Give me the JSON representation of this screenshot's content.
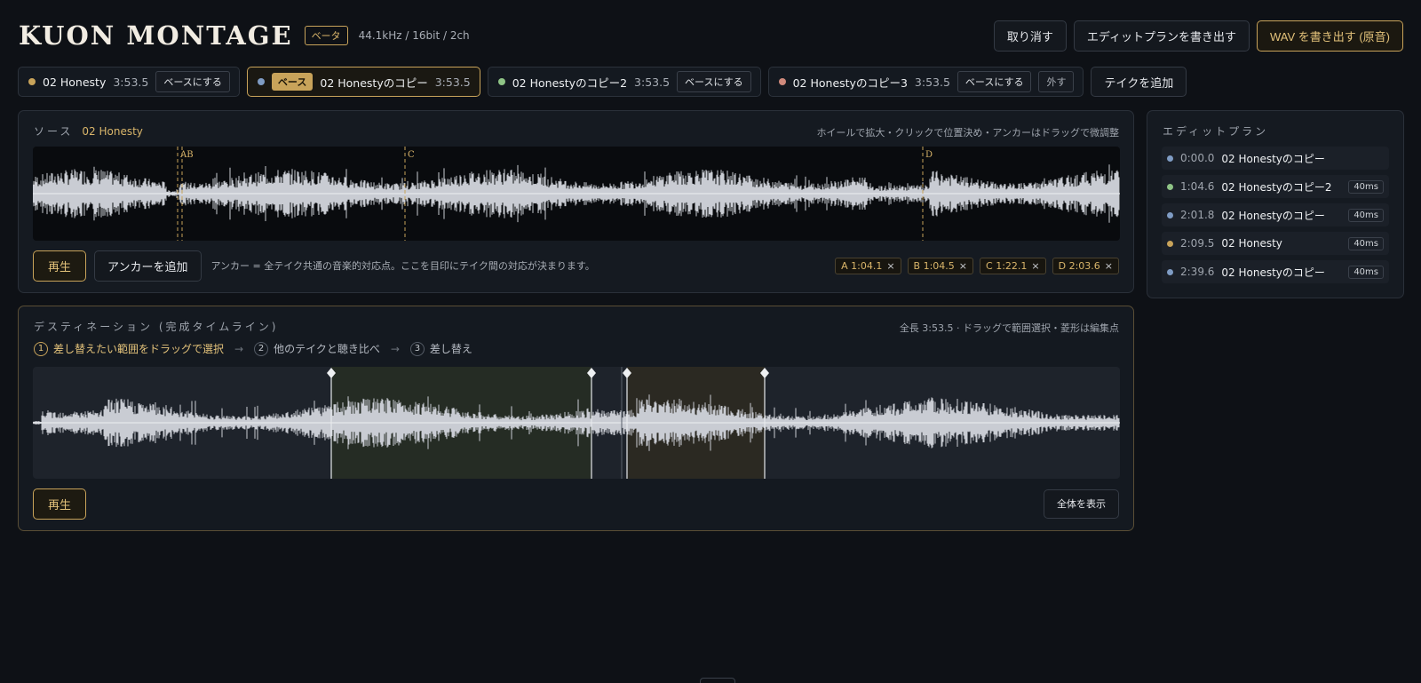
{
  "header": {
    "logo": "KUON MONTAGE",
    "beta": "ベータ",
    "spec": "44.1kHz / 16bit / 2ch",
    "undo": "取り消す",
    "export_plan": "エディットプランを書き出す",
    "export_wav": "WAV を書き出す (原音)"
  },
  "takes": [
    {
      "name": "02 Honesty",
      "duration": "3:53.5",
      "action": "ベースにする",
      "color": "#c8a35a"
    },
    {
      "name": "02 Honestyのコピー",
      "duration": "3:53.5",
      "badge": "ベース",
      "color": "#7f9cc4",
      "selected": true
    },
    {
      "name": "02 Honestyのコピー2",
      "duration": "3:53.5",
      "action": "ベースにする",
      "color": "#8fc486"
    },
    {
      "name": "02 Honestyのコピー3",
      "duration": "3:53.5",
      "action": "ベースにする",
      "remove": "外す",
      "color": "#d08a7c"
    }
  ],
  "add_take": "テイクを追加",
  "source": {
    "label": "ソース",
    "name": "02 Honesty",
    "hint": "ホイールで拡大・クリックで位置決め・アンカーはドラッグで微調整",
    "play": "再生",
    "add_anchor": "アンカーを追加",
    "anchor_note": "アンカー = 全テイク共通の音楽的対応点。ここを目印にテイク間の対応が決まります。",
    "marker_labels": {
      "ab": "AB",
      "c": "C",
      "d": "D"
    },
    "anchors": [
      {
        "label": "A 1:04.1",
        "x": "×"
      },
      {
        "label": "B 1:04.5",
        "x": "×"
      },
      {
        "label": "C 1:22.1",
        "x": "×"
      },
      {
        "label": "D 2:03.6",
        "x": "×"
      }
    ]
  },
  "destination": {
    "label": "デスティネーション (完成タイムライン)",
    "hint": "全長 3:53.5 · ドラッグで範囲選択・菱形は編集点",
    "steps": [
      {
        "num": "1",
        "label": "差し替えたい範囲をドラッグで選択"
      },
      {
        "num": "2",
        "label": "他のテイクと聴き比べ"
      },
      {
        "num": "3",
        "label": "差し替え"
      }
    ],
    "arrow": "→",
    "play": "再生",
    "fit": "全体を表示"
  },
  "plan": {
    "title": "エディットプラン",
    "rows": [
      {
        "time": "0:00.0",
        "name": "02 Honestyのコピー",
        "color": "#7f9cc4",
        "xfade": ""
      },
      {
        "time": "1:04.6",
        "name": "02 Honestyのコピー2",
        "color": "#8fc486",
        "xfade": "40ms"
      },
      {
        "time": "2:01.8",
        "name": "02 Honestyのコピー",
        "color": "#7f9cc4",
        "xfade": "40ms"
      },
      {
        "time": "2:09.5",
        "name": "02 Honesty",
        "color": "#c8a35a",
        "xfade": "40ms"
      },
      {
        "time": "2:39.6",
        "name": "02 Honestyのコピー",
        "color": "#7f9cc4",
        "xfade": "40ms"
      }
    ]
  },
  "colors": {
    "accent": "#c8a35a",
    "background": "#0e1116"
  }
}
